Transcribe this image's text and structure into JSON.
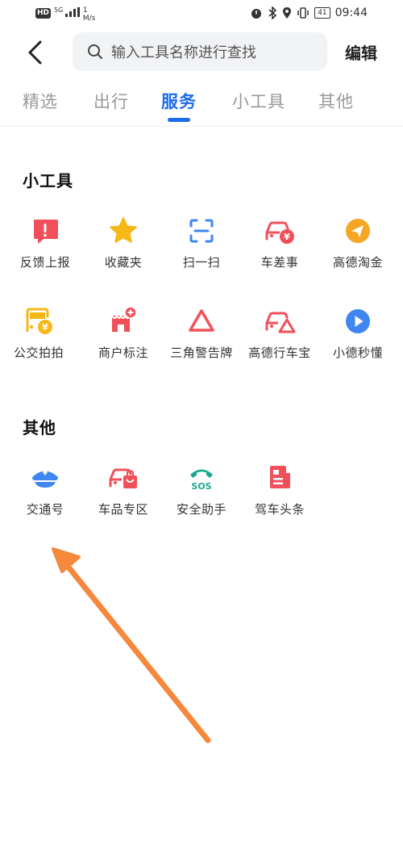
{
  "status_bar": {
    "network_badge": "HD",
    "signal": "5G",
    "speed_value": "1",
    "speed_unit": "M/s",
    "battery": "41",
    "time": "09:44"
  },
  "header": {
    "search_placeholder": "输入工具名称进行查找",
    "edit_label": "编辑"
  },
  "tabs": [
    {
      "label": "精选"
    },
    {
      "label": "出行"
    },
    {
      "label": "服务",
      "active": true
    },
    {
      "label": "小工具"
    },
    {
      "label": "其他"
    }
  ],
  "sections": [
    {
      "title": "小工具",
      "items": [
        {
          "label": "反馈上报",
          "icon": "feedback-icon"
        },
        {
          "label": "收藏夹",
          "icon": "star-icon"
        },
        {
          "label": "扫一扫",
          "icon": "scan-icon"
        },
        {
          "label": "车差事",
          "icon": "car-errand-icon"
        },
        {
          "label": "高德淘金",
          "icon": "gold-send-icon"
        },
        {
          "label": "公交拍拍",
          "icon": "bus-photo-icon"
        },
        {
          "label": "商户标注",
          "icon": "shop-mark-icon"
        },
        {
          "label": "三角警告牌",
          "icon": "warning-triangle-icon"
        },
        {
          "label": "高德行车宝",
          "icon": "car-treasure-icon"
        },
        {
          "label": "小德秒懂",
          "icon": "play-icon"
        }
      ]
    },
    {
      "title": "其他",
      "items": [
        {
          "label": "交通号",
          "icon": "police-cap-icon"
        },
        {
          "label": "车品专区",
          "icon": "car-shop-icon"
        },
        {
          "label": "安全助手",
          "icon": "sos-phone-icon"
        },
        {
          "label": "驾车头条",
          "icon": "news-icon"
        }
      ]
    }
  ],
  "colors": {
    "accent": "#1d6bf0",
    "red": "#f0505a",
    "yellow": "#f5b817",
    "blue": "#3f86f2",
    "teal": "#17a88f",
    "annotation_arrow": "#f5883c"
  }
}
